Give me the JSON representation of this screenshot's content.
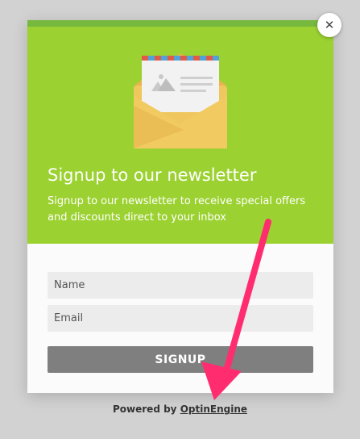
{
  "popup": {
    "headline": "Signup to our newsletter",
    "subtext": "Signup to our newsletter to receive special offers and discounts direct to your inbox",
    "close_glyph": "✕"
  },
  "form": {
    "name_placeholder": "Name",
    "email_placeholder": "Email",
    "submit_label": "SIGNUP"
  },
  "footer": {
    "prefix": "Powered by",
    "link_label": "OptinEngine"
  },
  "icons": {
    "envelope": "envelope-icon",
    "close": "close-icon",
    "annotation": "arrow-annotation"
  },
  "colors": {
    "hero_green": "#9bd130",
    "top_bar_green": "#77b83f",
    "button_gray": "#7f7f7f",
    "arrow_pink": "#ff2d6f"
  }
}
